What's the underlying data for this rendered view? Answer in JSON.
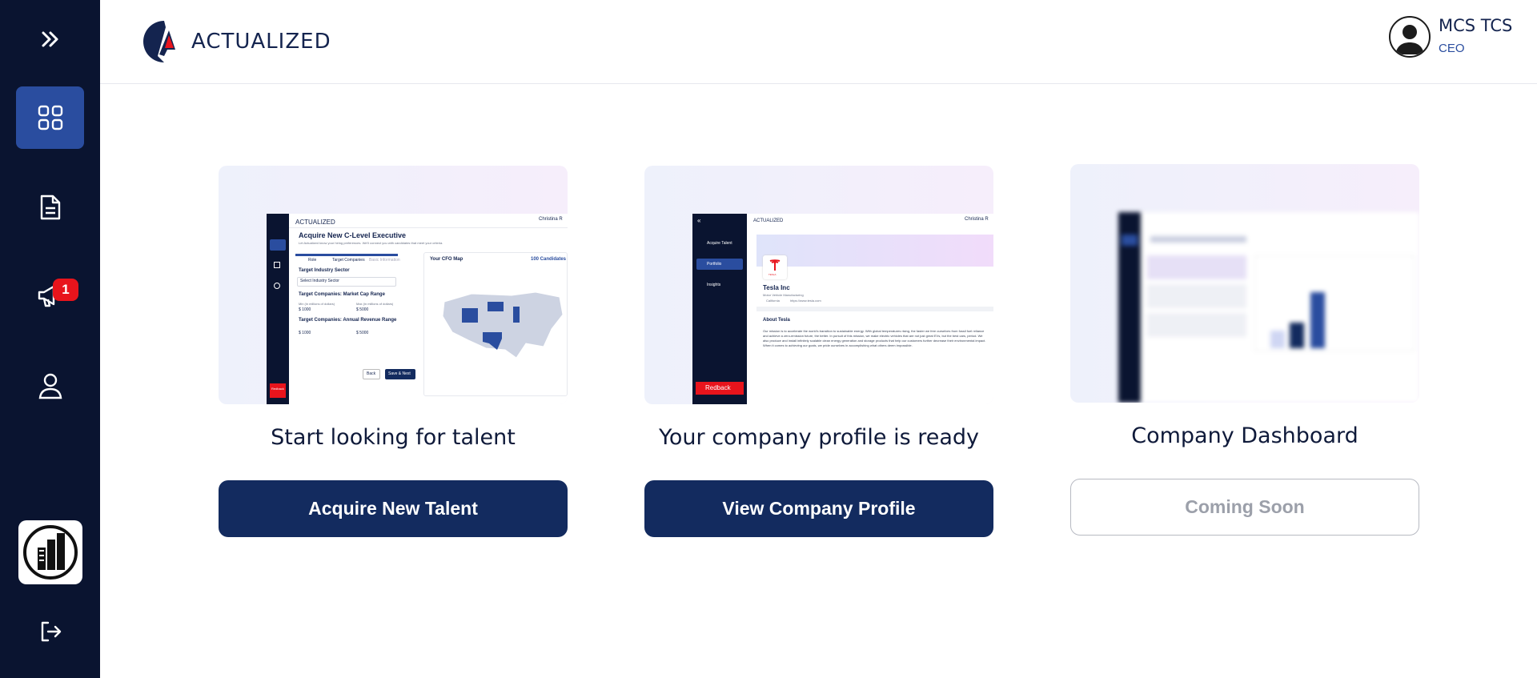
{
  "app": {
    "brand": "ACTUALIZED",
    "colors": {
      "sidebar": "#0a1430",
      "accent": "#2a4d9f",
      "primary_button": "#132b5f",
      "badge": "#e8141c"
    }
  },
  "sidebar": {
    "items": [
      {
        "icon": "double-chevron-right-icon"
      },
      {
        "icon": "grid-icon",
        "active": true
      },
      {
        "icon": "document-icon"
      },
      {
        "icon": "megaphone-icon",
        "badge": "1"
      },
      {
        "icon": "user-icon"
      },
      {
        "icon": "company-building-icon"
      },
      {
        "icon": "logout-icon"
      }
    ]
  },
  "header": {
    "user": {
      "name": "MCS TCS",
      "role": "CEO"
    }
  },
  "cards": [
    {
      "title": "Start looking for talent",
      "button": "Acquire New Talent",
      "preview": {
        "brand": "ACTUALIZED",
        "heading": "Acquire New C-Level Executive",
        "subheading": "Let Actualized know your hiring preferences. We'll connect you with candidates that meet your criteria.",
        "tabs": [
          "Role",
          "Target Companies",
          "Basic Information"
        ],
        "field1": "Target Industry Sector",
        "select": "Select Industry Sector",
        "field2": "Target Companies: Market Cap Range",
        "min_label": "Min (in millions of dollars)",
        "max_label": "Max (in millions of dollars)",
        "min1": "$ 1000",
        "max1": "$ 5000",
        "field3": "Target Companies: Annual Revenue Range",
        "min2": "$ 1000",
        "max2": "$ 5000",
        "back": "Back",
        "save": "Save & Next",
        "map_title": "Your CFO Map",
        "map_count": "100 Candidates",
        "user": "Christina R",
        "logo": "Redback"
      }
    },
    {
      "title": "Your company profile is ready",
      "button": "View Company Profile",
      "preview": {
        "brand": "ACTUALIZED",
        "nav": [
          "Acquire Talent",
          "Portfolio",
          "Insights"
        ],
        "company_logo_text": "TESLA",
        "company": "Tesla Inc",
        "industry": "Motor Vehicle Manufacturing",
        "location": "California",
        "website": "https://www.tesla.com",
        "about_title": "About Tesla",
        "about": "Our mission is to accelerate the world's transition to sustainable energy. With global temperatures rising, the faster we free ourselves from fossil fuel reliance and achieve a zero-emission future, the better. In pursuit of this mission, we make electric vehicles that are not just great EVs, but the best cars, period. We also produce and install infinitely scalable clean energy generation and storage products that help our customers further decrease their environmental impact. When it comes to achieving our goals, we pride ourselves in accomplishing what others deem impossible.",
        "user": "Christina R",
        "logo": "Redback"
      }
    },
    {
      "title": "Company Dashboard",
      "button": "Coming Soon",
      "disabled": true
    }
  ]
}
